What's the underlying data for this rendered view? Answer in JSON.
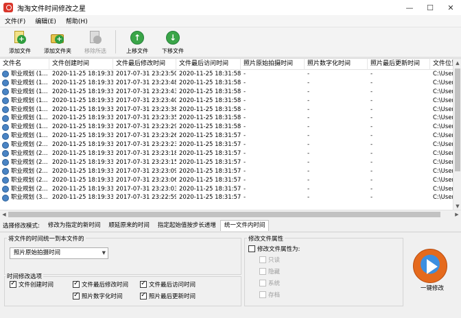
{
  "window": {
    "title": "淘淘文件时间修改之星",
    "min": "—",
    "max": "☐",
    "close": "✕"
  },
  "menu": [
    "文件(F)",
    "编辑(E)",
    "帮助(H)"
  ],
  "toolbar": {
    "add_file": "添加文件",
    "add_folder": "添加文件夹",
    "remove_selected": "移除所选",
    "move_up": "上移文件",
    "move_down": "下移文件"
  },
  "table": {
    "columns": [
      "文件名",
      "文件创建时间",
      "文件最后修改时间",
      "文件最后访问时间",
      "照片原始拍摄时间",
      "照片数字化时间",
      "照片最后更新时间",
      "文件位置"
    ],
    "rows": [
      [
        "职业规划 (1...",
        "2020-11-25 18:19:33",
        "2017-07-31 23:23:50",
        "2020-11-25 18:31:58",
        "-",
        "-",
        "-",
        "C:\\User"
      ],
      [
        "职业规划 (1...",
        "2020-11-25 18:19:33",
        "2017-07-31 23:23:48",
        "2020-11-25 18:31:58",
        "-",
        "-",
        "-",
        "C:\\User"
      ],
      [
        "职业规划 (1...",
        "2020-11-25 18:19:33",
        "2017-07-31 23:23:43",
        "2020-11-25 18:31:58",
        "-",
        "-",
        "-",
        "C:\\User"
      ],
      [
        "职业规划 (1...",
        "2020-11-25 18:19:33",
        "2017-07-31 23:23:40",
        "2020-11-25 18:31:58",
        "-",
        "-",
        "-",
        "C:\\User"
      ],
      [
        "职业规划 (1...",
        "2020-11-25 18:19:33",
        "2017-07-31 23:23:38",
        "2020-11-25 18:31:58",
        "-",
        "-",
        "-",
        "C:\\User"
      ],
      [
        "职业规划 (1...",
        "2020-11-25 18:19:33",
        "2017-07-31 23:23:35",
        "2020-11-25 18:31:58",
        "-",
        "-",
        "-",
        "C:\\User"
      ],
      [
        "职业规划 (1...",
        "2020-11-25 18:19:33",
        "2017-07-31 23:23:29",
        "2020-11-25 18:31:58",
        "-",
        "-",
        "-",
        "C:\\User"
      ],
      [
        "职业规划 (1...",
        "2020-11-25 18:19:33",
        "2017-07-31 23:23:26",
        "2020-11-25 18:31:57",
        "-",
        "-",
        "-",
        "C:\\User"
      ],
      [
        "职业规划 (2...",
        "2020-11-25 18:19:33",
        "2017-07-31 23:23:23",
        "2020-11-25 18:31:57",
        "-",
        "-",
        "-",
        "C:\\User"
      ],
      [
        "职业规划 (2...",
        "2020-11-25 18:19:33",
        "2017-07-31 23:23:18",
        "2020-11-25 18:31:57",
        "-",
        "-",
        "-",
        "C:\\User"
      ],
      [
        "职业规划 (2...",
        "2020-11-25 18:19:33",
        "2017-07-31 23:23:15",
        "2020-11-25 18:31:57",
        "-",
        "-",
        "-",
        "C:\\User"
      ],
      [
        "职业规划 (2...",
        "2020-11-25 18:19:33",
        "2017-07-31 23:23:09",
        "2020-11-25 18:31:57",
        "-",
        "-",
        "-",
        "C:\\User"
      ],
      [
        "职业规划 (2...",
        "2020-11-25 18:19:33",
        "2017-07-31 23:23:06",
        "2020-11-25 18:31:57",
        "-",
        "-",
        "-",
        "C:\\User"
      ],
      [
        "职业规划 (2...",
        "2020-11-25 18:19:33",
        "2017-07-31 23:23:03",
        "2020-11-25 18:31:57",
        "-",
        "-",
        "-",
        "C:\\User"
      ],
      [
        "职业规划 (3...",
        "2020-11-25 18:19:33",
        "2017-07-31 23:22:59",
        "2020-11-25 18:31:57",
        "-",
        "-",
        "-",
        "C:\\User"
      ]
    ]
  },
  "modes": {
    "label": "选择修改模式:",
    "tabs": [
      "修改为指定的新时间",
      "顺延原来的时间",
      "指定起始值按步长递增",
      "统一文件内时间"
    ],
    "active_index": 3
  },
  "unify": {
    "group_title": "将文件的时间统一到本文件的",
    "select_value": "照片原始拍摄时间"
  },
  "time_options": {
    "group_title": "时间修改选项",
    "items": [
      {
        "label": "文件创建时间",
        "checked": true
      },
      {
        "label": "文件最后修改时间",
        "checked": true
      },
      {
        "label": "文件最后访问时间",
        "checked": true
      },
      {
        "label": "照片数字化时间",
        "checked": true
      },
      {
        "label": "照片最后更新时间",
        "checked": true
      }
    ]
  },
  "attributes": {
    "group_title": "修改文件属性",
    "main_checkbox": "修改文件属性为:",
    "main_checked": false,
    "items": [
      "只读",
      "隐藏",
      "系统",
      "存档"
    ]
  },
  "action": {
    "label": "一键修改"
  }
}
